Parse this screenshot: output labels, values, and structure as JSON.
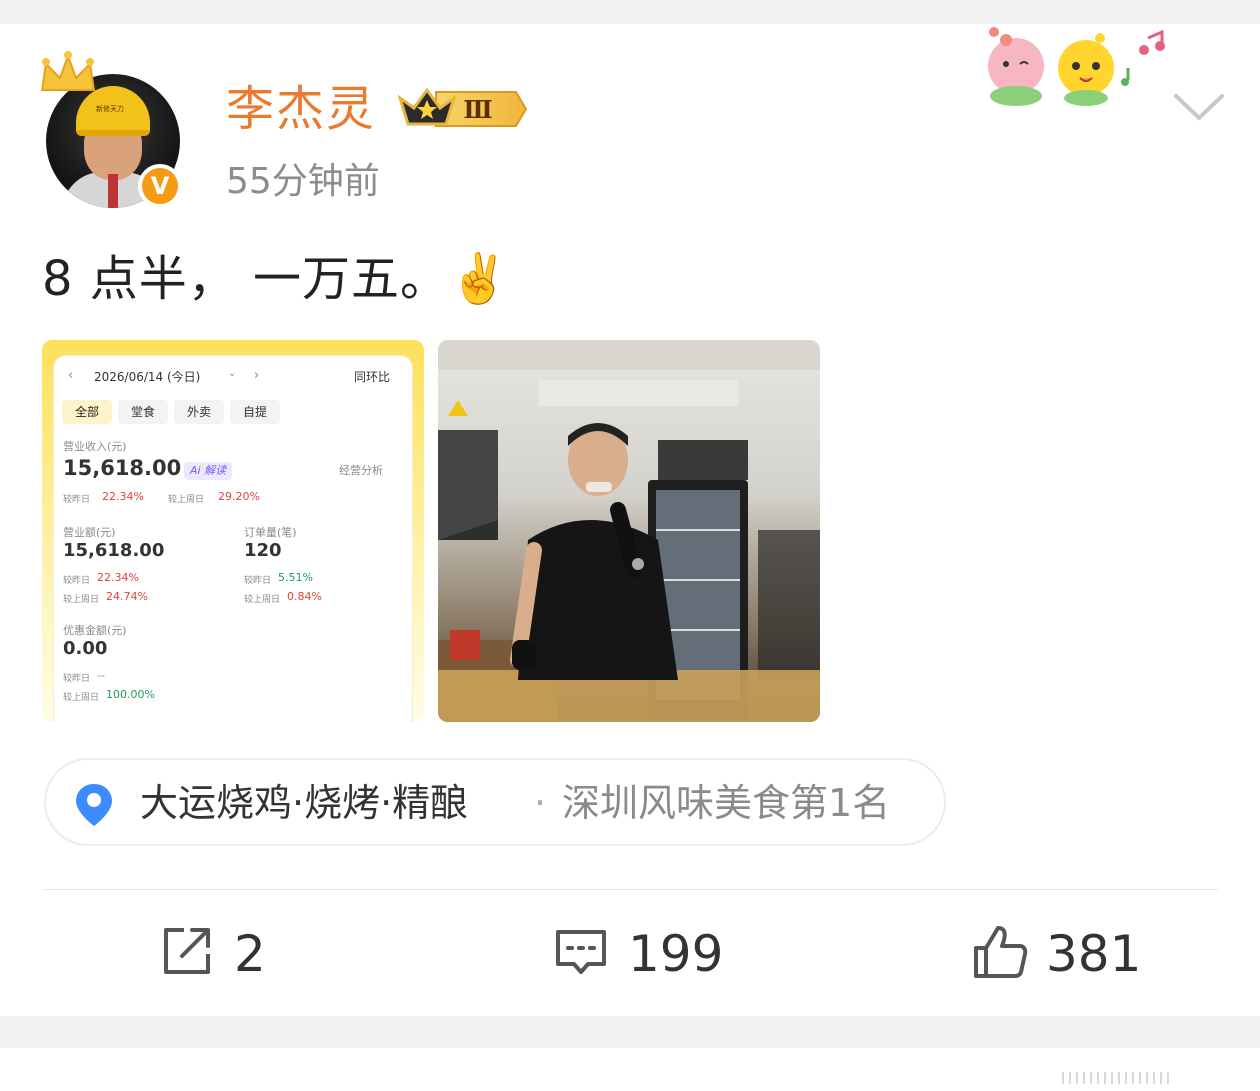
{
  "post": {
    "username": "李杰灵",
    "level_badge": "Ⅲ",
    "verified_mark": "V",
    "avatar_helmet_text": "新修天力",
    "timestamp": "55分钟前",
    "text": "8 点半， 一万五。",
    "emoji": "✌️"
  },
  "sales_screenshot": {
    "date": "2026/06/14 (今日)",
    "compare_mode": "同环比",
    "tabs": [
      "全部",
      "堂食",
      "外卖",
      "自提"
    ],
    "revenue_label": "营业收入(元)",
    "revenue_value": "15,618.00",
    "ai_tag": "Ai 解读",
    "analysis_link": "经营分析",
    "revenue_vs_yesterday_label": "较昨日",
    "revenue_vs_yesterday": "22.34%",
    "revenue_vs_last_week_label": "较上周日",
    "revenue_vs_last_week": "29.20%",
    "turnover_label": "营业额(元)",
    "turnover_value": "15,618.00",
    "turnover_vs_yesterday_label": "较昨日",
    "turnover_vs_yesterday": "22.34%",
    "turnover_vs_last_week_label": "较上周日",
    "turnover_vs_last_week": "24.74%",
    "orders_label": "订单量(笔)",
    "orders_value": "120",
    "orders_vs_yesterday_label": "较昨日",
    "orders_vs_yesterday": "5.51%",
    "orders_vs_last_week_label": "较上周日",
    "orders_vs_last_week": "0.84%",
    "discount_label": "优惠金额(元)",
    "discount_value": "0.00",
    "discount_vs_yesterday_label": "较昨日",
    "discount_vs_yesterday": "--",
    "discount_vs_last_week_label": "较上周日",
    "discount_vs_last_week": "100.00%"
  },
  "location": {
    "name": "大运烧鸡·烧烤·精酿",
    "separator": "·",
    "rank": "深圳风味美食第1名"
  },
  "actions": {
    "repost_count": "2",
    "comment_count": "199",
    "like_count": "381"
  },
  "icons": {
    "repost": "share-icon",
    "comment": "comment-icon",
    "like": "thumbs-up-icon",
    "location": "location-pin-icon",
    "more": "chevron-down-icon"
  },
  "colors": {
    "username": "#ea7a2e",
    "location_pin": "#3d8bff",
    "up": "#e1423a",
    "down": "#1f9d59"
  }
}
